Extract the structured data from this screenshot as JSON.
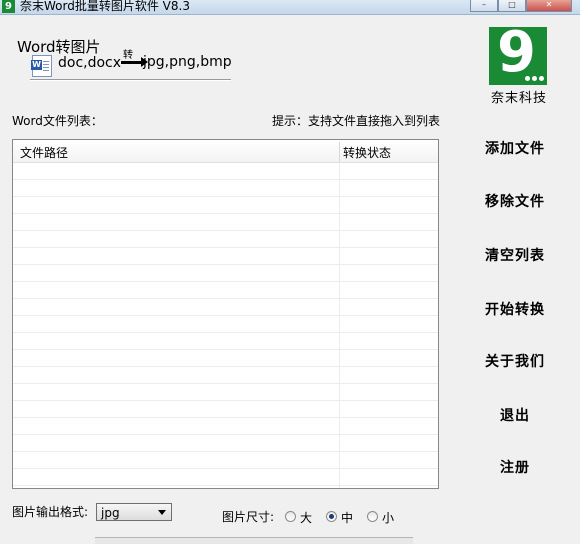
{
  "window": {
    "title": "奈末Word批量转图片软件 V8.3",
    "app_icon": "9",
    "controls": {
      "minimize": "–",
      "maximize": "□",
      "close": "✕"
    }
  },
  "header": {
    "title": "Word转图片",
    "source_formats": "doc,docx",
    "arrow_label": "转",
    "target_formats": "jpg,png,bmp",
    "word_icon": "W"
  },
  "logo": {
    "digit": "9",
    "caption": "奈末科技"
  },
  "list": {
    "label": "Word文件列表：",
    "hint": "提示：支持文件直接拖入到列表",
    "columns": [
      "文件路径",
      "转换状态"
    ],
    "rows": []
  },
  "actions": {
    "add": "添加文件",
    "remove": "移除文件",
    "clear": "清空列表",
    "start": "开始转换",
    "about": "关于我们",
    "exit": "退出",
    "register": "注册"
  },
  "options": {
    "format_label": "图片输出格式:",
    "format_value": "jpg",
    "size_label": "图片尺寸:",
    "sizes": [
      "大",
      "中",
      "小"
    ],
    "size_selected": "中"
  }
}
